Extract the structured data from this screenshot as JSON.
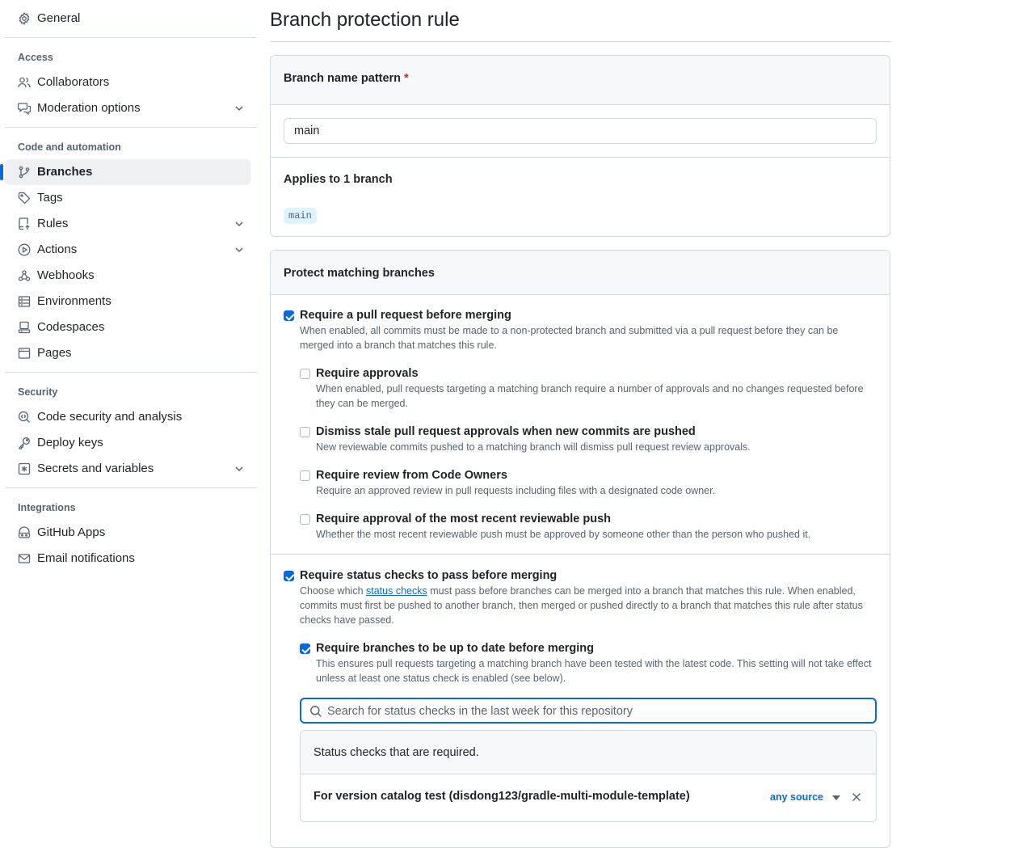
{
  "sidebar": {
    "general": "General",
    "sections": {
      "access": "Access",
      "code_automation": "Code and automation",
      "security": "Security",
      "integrations": "Integrations"
    },
    "items": {
      "collaborators": "Collaborators",
      "moderation": "Moderation options",
      "branches": "Branches",
      "tags": "Tags",
      "rules": "Rules",
      "actions": "Actions",
      "webhooks": "Webhooks",
      "environments": "Environments",
      "codespaces": "Codespaces",
      "pages": "Pages",
      "code_security": "Code security and analysis",
      "deploy_keys": "Deploy keys",
      "secrets": "Secrets and variables",
      "github_apps": "GitHub Apps",
      "email_notifications": "Email notifications"
    },
    "active_item": "Branches"
  },
  "page": {
    "title": "Branch protection rule"
  },
  "pattern_box": {
    "label": "Branch name pattern",
    "required_marker": "*",
    "value": "main",
    "applies_label": "Applies to 1 branch",
    "matched_branch": "main"
  },
  "protect_box": {
    "heading": "Protect matching branches",
    "require_pr": {
      "checked": true,
      "title": "Require a pull request before merging",
      "desc": "When enabled, all commits must be made to a non-protected branch and submitted via a pull request before they can be merged into a branch that matches this rule."
    },
    "require_approvals": {
      "checked": false,
      "title": "Require approvals",
      "desc": "When enabled, pull requests targeting a matching branch require a number of approvals and no changes requested before they can be merged."
    },
    "dismiss_stale": {
      "checked": false,
      "title": "Dismiss stale pull request approvals when new commits are pushed",
      "desc": "New reviewable commits pushed to a matching branch will dismiss pull request review approvals."
    },
    "code_owners": {
      "checked": false,
      "title": "Require review from Code Owners",
      "desc": "Require an approved review in pull requests including files with a designated code owner."
    },
    "recent_push": {
      "checked": false,
      "title": "Require approval of the most recent reviewable push",
      "desc": "Whether the most recent reviewable push must be approved by someone other than the person who pushed it."
    },
    "status_checks": {
      "checked": true,
      "title": "Require status checks to pass before merging",
      "desc_before": "Choose which ",
      "desc_link": "status checks",
      "desc_after": " must pass before branches can be merged into a branch that matches this rule. When enabled, commits must first be pushed to another branch, then merged or pushed directly to a branch that matches this rule after status checks have passed."
    },
    "up_to_date": {
      "checked": true,
      "title": "Require branches to be up to date before merging",
      "desc": "This ensures pull requests targeting a matching branch have been tested with the latest code. This setting will not take effect unless at least one status check is enabled (see below)."
    },
    "search": {
      "placeholder": "Search for status checks in the last week for this repository",
      "value": ""
    },
    "required_checks": {
      "heading": "Status checks that are required.",
      "items": [
        {
          "name": "For version catalog test (disdong123/gradle-multi-module-template)",
          "source": "any source"
        }
      ]
    }
  },
  "colors": {
    "accent": "#0969da",
    "required": "#d1242f",
    "muted": "#59636e",
    "border": "#d1d9e0"
  }
}
